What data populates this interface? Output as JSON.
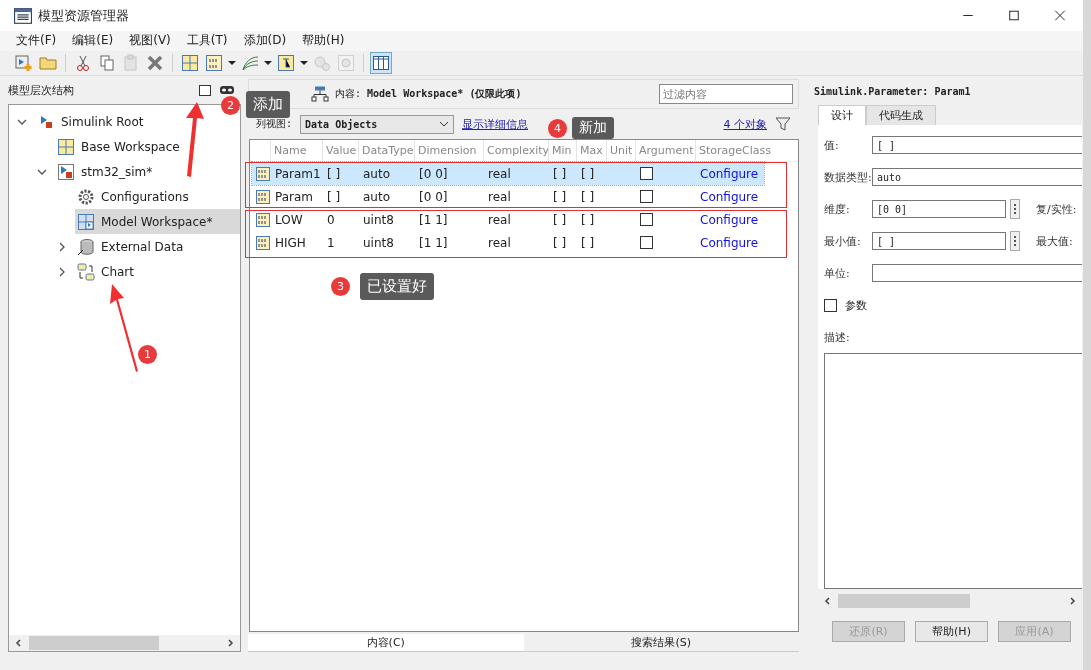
{
  "window": {
    "title": "模型资源管理器"
  },
  "menu": [
    "文件(F)",
    "编辑(E)",
    "视图(V)",
    "工具(T)",
    "添加(D)",
    "帮助(H)"
  ],
  "hierarchy": {
    "title": "模型层次结构",
    "items": [
      {
        "label": "Simulink Root",
        "kind": "root",
        "expanded": true,
        "selected": false,
        "children": [
          {
            "label": "Base Workspace",
            "kind": "workspace",
            "selected": false
          },
          {
            "label": "stm32_sim*",
            "kind": "model",
            "expanded": true,
            "selected": false,
            "children": [
              {
                "label": "Configurations",
                "kind": "config",
                "selected": false
              },
              {
                "label": "Model Workspace*",
                "kind": "modelws",
                "selected": true
              },
              {
                "label": "External Data",
                "kind": "data",
                "expanded": false,
                "selected": false
              },
              {
                "label": "Chart",
                "kind": "chart",
                "expanded": false,
                "selected": false
              }
            ]
          }
        ]
      }
    ]
  },
  "contents": {
    "label": "内容:",
    "path": "Model Workspace* (仅限此项)",
    "filter": {
      "placeholder": "过滤内容"
    },
    "view_label": "列视图:",
    "view": "Data Objects",
    "details_link": "显示详细信息",
    "count_link": "4 个对象",
    "columns": [
      "Name",
      "Value",
      "DataType",
      "Dimension",
      "Complexity",
      "Min",
      "Max",
      "Unit",
      "Argument",
      "StorageClass"
    ],
    "rows": [
      {
        "name": "Param1",
        "value": "[ ]",
        "datatype": "auto",
        "dimension": "[0 0]",
        "complexity": "real",
        "min": "[ ]",
        "max": "[ ]",
        "argument": false,
        "storage": "Configure",
        "selected": true
      },
      {
        "name": "Param",
        "value": "[ ]",
        "datatype": "auto",
        "dimension": "[0 0]",
        "complexity": "real",
        "min": "[ ]",
        "max": "[ ]",
        "argument": false,
        "storage": "Configure",
        "selected": false
      },
      {
        "name": "LOW",
        "value": "0",
        "datatype": "uint8",
        "dimension": "[1 1]",
        "complexity": "real",
        "min": "[ ]",
        "max": "[ ]",
        "argument": false,
        "storage": "Configure",
        "selected": false
      },
      {
        "name": "HIGH",
        "value": "1",
        "datatype": "uint8",
        "dimension": "[1 1]",
        "complexity": "real",
        "min": "[ ]",
        "max": "[ ]",
        "argument": false,
        "storage": "Configure",
        "selected": false
      }
    ],
    "bottom_tabs": [
      {
        "label": "内容(C)",
        "selected": true
      },
      {
        "label": "搜索结果(S)",
        "selected": false
      }
    ]
  },
  "properties": {
    "title": "Simulink.Parameter: Param1",
    "tabs": [
      {
        "label": "设计",
        "selected": true
      },
      {
        "label": "代码生成",
        "selected": false
      }
    ],
    "value_label": "值:",
    "value": "[ ]",
    "type_label": "数据类型:",
    "type": "auto",
    "dims_label": "维度:",
    "dims": "[0 0]",
    "complexity_label": "复/实性:",
    "min_label": "最小值:",
    "min": "[ ]",
    "max_label": "最大值:",
    "unit_label": "单位:",
    "argument": {
      "label": "参数",
      "checked": false
    },
    "description_label": "描述:",
    "buttons": [
      {
        "label": "还原(R)",
        "disabled": true
      },
      {
        "label": "帮助(H)",
        "disabled": false
      },
      {
        "label": "应用(A)",
        "disabled": true
      }
    ]
  },
  "annotations": [
    {
      "number": "1"
    },
    {
      "number": "2",
      "callout": "添加"
    },
    {
      "number": "3",
      "callout": "已设置好"
    },
    {
      "number": "4",
      "callout": "新加"
    }
  ]
}
